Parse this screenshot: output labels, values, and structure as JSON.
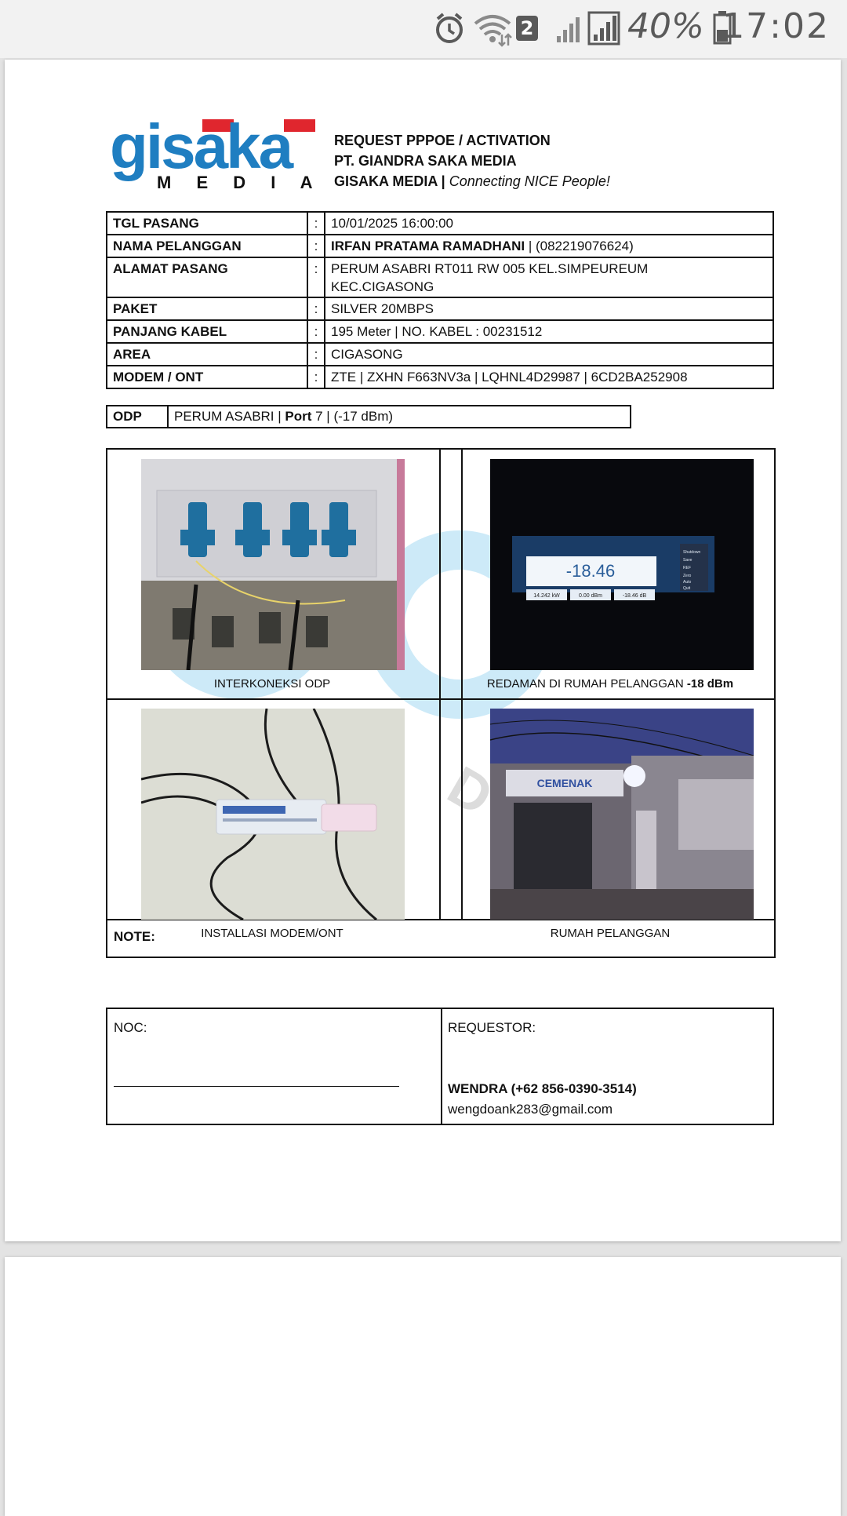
{
  "status_bar": {
    "signal_badge": "2",
    "battery_percent": "40%",
    "time": "17:02",
    "icons": [
      "alarm-icon",
      "wifi-icon",
      "sim-badge-icon",
      "cell-signal-icon",
      "cell-signal-icon",
      "battery-icon"
    ]
  },
  "header": {
    "logo_word": "gisaka",
    "logo_sub": "M E D I A",
    "line1": "REQUEST PPPOE / ACTIVATION",
    "line2": "PT. GIANDRA SAKA MEDIA",
    "line3_company": "GISAKA MEDIA | ",
    "line3_tagline": "Connecting NICE People!"
  },
  "info": {
    "colon": ":",
    "tgl_label": "TGL PASANG",
    "tgl_value": "10/01/2025 16:00:00",
    "nama_label": "NAMA PELANGGAN",
    "nama_name": "IRFAN PRATAMA RAMADHANI",
    "nama_phone": " | (082219076624)",
    "alamat_label": "ALAMAT PASANG",
    "alamat_line1": "PERUM ASABRI RT011 RW 005 KEL.SIMPEUREUM",
    "alamat_line2": "KEC.CIGASONG",
    "paket_label": "PAKET",
    "paket_value": "SILVER 20MBPS",
    "kabel_label": "PANJANG KABEL",
    "kabel_value": "195  Meter  | NO. KABEL : 00231512",
    "area_label": "AREA",
    "area_value": "CIGASONG",
    "modem_label": "MODEM / ONT",
    "modem_value": "ZTE |  ZXHN F663NV3a | LQHNL4D29987 |  6CD2BA252908"
  },
  "odp": {
    "label": "ODP",
    "value_a": "PERUM ASABRI | ",
    "port_label": "Port",
    "value_b": " 7 |  (-17 dBm)"
  },
  "photos": {
    "caption1": "INTERKONEKSI ODP",
    "caption2_a": "REDAMAN DI RUMAH PELANGGAN ",
    "caption2_b": "-18 dBm",
    "caption3": "INSTALLASI MODEM/ONT",
    "caption4": "RUMAH PELANGGAN",
    "meter_value": "-18.46",
    "meter_sub1": "14.242 kW",
    "meter_sub2": "0.00 dBm",
    "meter_sub3": "-18.46 dB",
    "meter_menu": [
      "Shutdown",
      "Save",
      "REF",
      "Zero",
      "Auto",
      "Quit"
    ],
    "house_sign": "CEMENAK"
  },
  "note": {
    "label": "NOTE:"
  },
  "signatures": {
    "noc_label": "NOC:",
    "requestor_label": "REQUESTOR:",
    "requestor_name": "WENDRA (+62 856-0390-3514)",
    "requestor_email": "wengdoank283@gmail.com"
  },
  "colors": {
    "logo_blue": "#1f7ec1",
    "logo_red": "#e0262e",
    "border": "#111111"
  }
}
